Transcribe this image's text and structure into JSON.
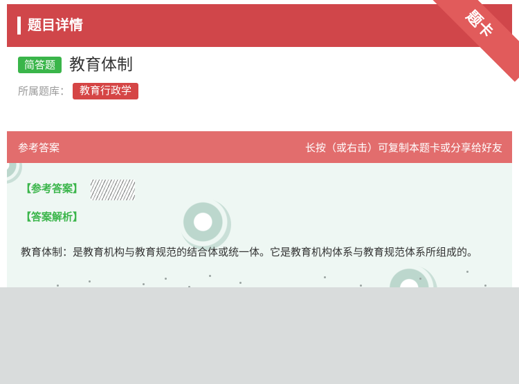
{
  "header": {
    "title": "题目详情",
    "corner_label": "题卡"
  },
  "question": {
    "type_badge": "简答题",
    "title": "教育体制"
  },
  "bank": {
    "label": "所属题库：",
    "tag": "教育行政学"
  },
  "answer_header": {
    "left": "参考答案",
    "right": "长按（或右击）可复制本题卡或分享给好友"
  },
  "answer": {
    "ref_label": "【参考答案】",
    "explain_label": "【答案解析】",
    "explain_text": "教育体制：是教育机构与教育规范的结合体或统一体。它是教育机构体系与教育规范体系所组成的。"
  },
  "colors": {
    "header": "#d0464a",
    "corner": "#e15b5b",
    "answer_header": "#e26d6d",
    "badge_green": "#3ab54a",
    "tag_red": "#d54545"
  }
}
